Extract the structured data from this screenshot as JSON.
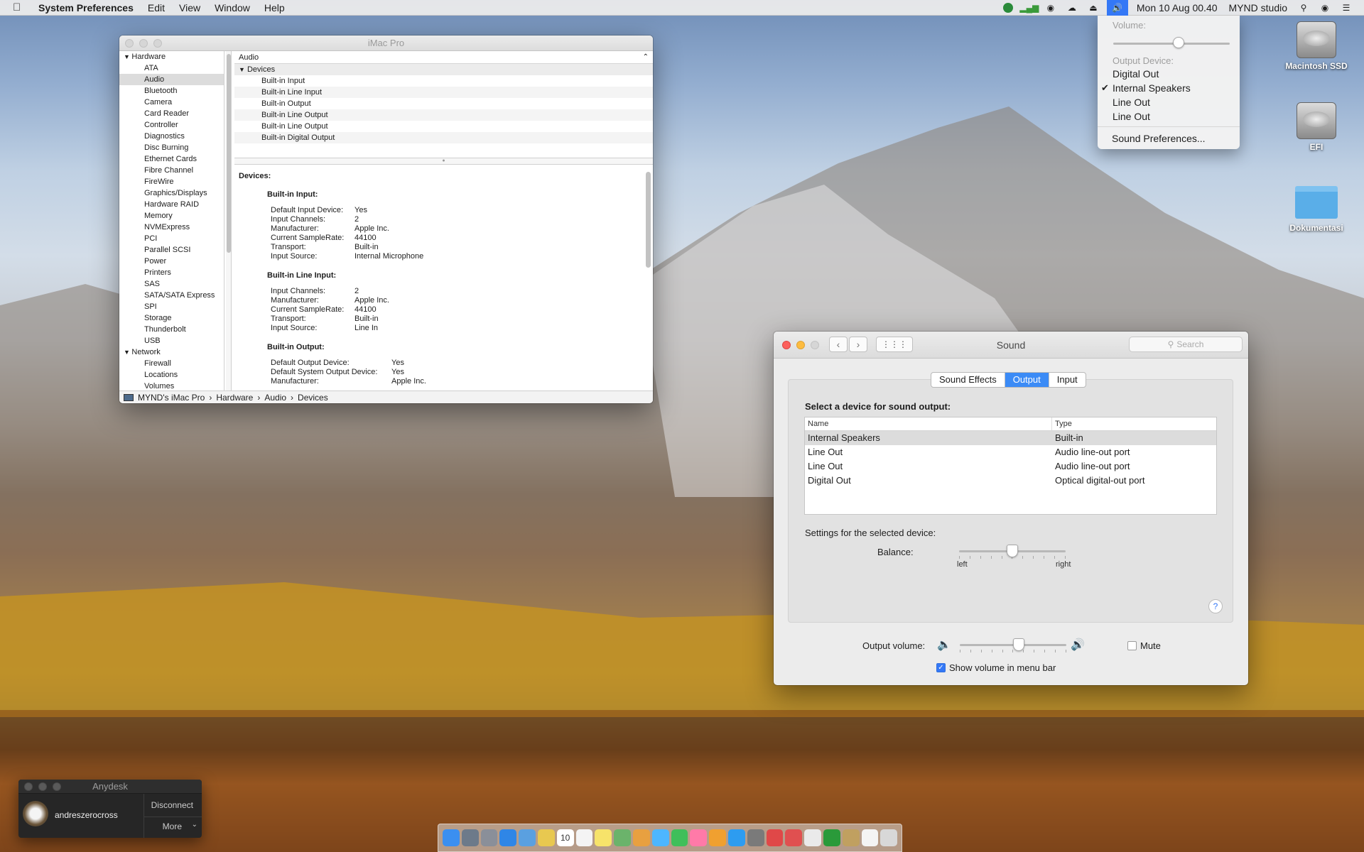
{
  "menubar": {
    "app_name": "System Preferences",
    "items": [
      "Edit",
      "View",
      "Window",
      "Help"
    ],
    "clock": "Mon 10 Aug  00.40",
    "user": "MYND studio",
    "status_icons": [
      "globe-icon",
      "signal-bars-icon",
      "nvidia-icon",
      "activity-icon",
      "eject-icon",
      "volume-icon"
    ]
  },
  "volume_menu": {
    "volume_label": "Volume:",
    "volume_level": 0.56,
    "output_label": "Output Device:",
    "devices": [
      "Digital Out",
      "Internal Speakers",
      "Line Out",
      "Line Out"
    ],
    "selected": "Internal Speakers",
    "prefs_link": "Sound Preferences..."
  },
  "desktop_icons": [
    {
      "label": "Macintosh SSD",
      "icon": "hard-drive-icon"
    },
    {
      "label": "EFI",
      "icon": "hard-drive-icon"
    },
    {
      "label": "Dokumentasi",
      "icon": "folder-icon"
    }
  ],
  "sysinfo": {
    "title": "iMac Pro",
    "sidebar": [
      {
        "label": "Hardware",
        "group": true
      },
      {
        "label": "ATA"
      },
      {
        "label": "Audio",
        "selected": true
      },
      {
        "label": "Bluetooth"
      },
      {
        "label": "Camera"
      },
      {
        "label": "Card Reader"
      },
      {
        "label": "Controller"
      },
      {
        "label": "Diagnostics"
      },
      {
        "label": "Disc Burning"
      },
      {
        "label": "Ethernet Cards"
      },
      {
        "label": "Fibre Channel"
      },
      {
        "label": "FireWire"
      },
      {
        "label": "Graphics/Displays"
      },
      {
        "label": "Hardware RAID"
      },
      {
        "label": "Memory"
      },
      {
        "label": "NVMExpress"
      },
      {
        "label": "PCI"
      },
      {
        "label": "Parallel SCSI"
      },
      {
        "label": "Power"
      },
      {
        "label": "Printers"
      },
      {
        "label": "SAS"
      },
      {
        "label": "SATA/SATA Express"
      },
      {
        "label": "SPI"
      },
      {
        "label": "Storage"
      },
      {
        "label": "Thunderbolt"
      },
      {
        "label": "USB"
      },
      {
        "label": "Network",
        "group": true
      },
      {
        "label": "Firewall"
      },
      {
        "label": "Locations"
      },
      {
        "label": "Volumes"
      }
    ],
    "list_header": "Audio",
    "group_label": "Devices",
    "devices": [
      "Built-in Input",
      "Built-in Line Input",
      "Built-in Output",
      "Built-in Line Output",
      "Built-in Line Output",
      "Built-in Digital Output"
    ],
    "detail_heading": "Devices:",
    "sections": [
      {
        "title": "Built-in Input:",
        "rows": [
          [
            "Default Input Device:",
            "Yes"
          ],
          [
            "Input Channels:",
            "2"
          ],
          [
            "Manufacturer:",
            "Apple Inc."
          ],
          [
            "Current SampleRate:",
            "44100"
          ],
          [
            "Transport:",
            "Built-in"
          ],
          [
            "Input Source:",
            "Internal Microphone"
          ]
        ]
      },
      {
        "title": "Built-in Line Input:",
        "rows": [
          [
            "Input Channels:",
            "2"
          ],
          [
            "Manufacturer:",
            "Apple Inc."
          ],
          [
            "Current SampleRate:",
            "44100"
          ],
          [
            "Transport:",
            "Built-in"
          ],
          [
            "Input Source:",
            "Line In"
          ]
        ]
      },
      {
        "title": "Built-in Output:",
        "rows": [
          [
            "Default Output Device:",
            "Yes"
          ],
          [
            "Default System Output Device:",
            "Yes"
          ],
          [
            "Manufacturer:",
            "Apple Inc."
          ]
        ]
      }
    ],
    "path": [
      "MYND's iMac Pro",
      "Hardware",
      "Audio",
      "Devices"
    ]
  },
  "sound": {
    "title": "Sound",
    "search_placeholder": "Search",
    "tabs": [
      "Sound Effects",
      "Output",
      "Input"
    ],
    "active_tab": "Output",
    "select_label": "Select a device for sound output:",
    "columns": [
      "Name",
      "Type"
    ],
    "devices": [
      {
        "name": "Internal Speakers",
        "type": "Built-in",
        "selected": true
      },
      {
        "name": "Line Out",
        "type": "Audio line-out port"
      },
      {
        "name": "Line Out",
        "type": "Audio line-out port"
      },
      {
        "name": "Digital Out",
        "type": "Optical digital-out port"
      }
    ],
    "settings_label": "Settings for the selected device:",
    "balance_label": "Balance:",
    "balance_value": 0.5,
    "balance_left": "left",
    "balance_right": "right",
    "output_volume_label": "Output volume:",
    "output_volume_value": 0.55,
    "mute_label": "Mute",
    "mute_checked": false,
    "show_volume_label": "Show volume in menu bar",
    "show_volume_checked": true,
    "help": "?"
  },
  "anydesk": {
    "title": "Anydesk",
    "user": "andreszerocross",
    "disconnect": "Disconnect",
    "more": "More"
  },
  "dock": {
    "calendar_day": "10",
    "apps": [
      "finder-icon",
      "launchpad-icon",
      "rocket-icon",
      "safari-icon",
      "mail-icon",
      "notes-icon",
      "calendar-icon",
      "reminders-icon",
      "stickies-icon",
      "maps-icon",
      "photos-icon",
      "messages-icon",
      "facetime-icon",
      "itunes-icon",
      "ibooks-icon",
      "appstore-icon",
      "system-preferences-icon",
      "anydesk-icon",
      "anydesk-alt-icon",
      "textedit-icon",
      "globe-icon",
      "trash-folder-icon",
      "document-icon",
      "trash-icon"
    ]
  },
  "colors": {
    "accent": "#3478f6",
    "close": "#fc605c",
    "minimize": "#fdbc40"
  }
}
